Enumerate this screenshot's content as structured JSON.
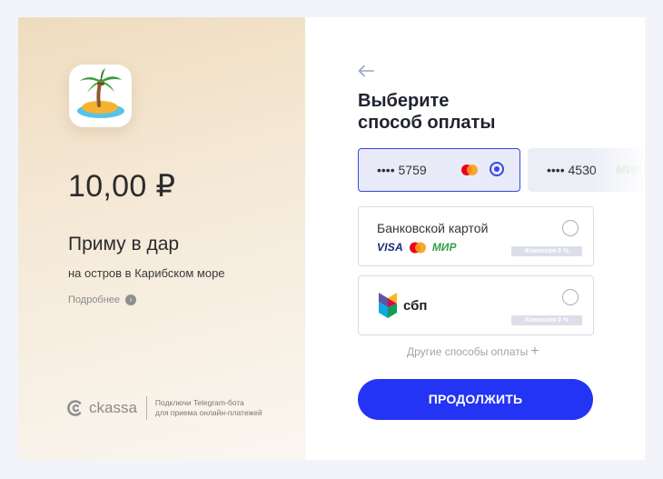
{
  "merchant": {
    "amount": "10,00 ₽",
    "product_title": "Приму в дар",
    "product_description": "на остров в Карибском море",
    "more_link": "Подробнее",
    "icon": "palm-island-icon"
  },
  "brand": {
    "name": "ckassa",
    "promo_line1": "Подключи Telegram-бота",
    "promo_line2": "для приема онлайн-платежей"
  },
  "payment": {
    "title_line1": "Выберите",
    "title_line2": "способ оплаты",
    "saved_cards": [
      {
        "number": "•••• 5759",
        "brand": "mastercard",
        "selected": true
      },
      {
        "number": "•••• 4530",
        "brand_label": "МИР",
        "selected": false
      }
    ],
    "methods": [
      {
        "label": "Банковской картой",
        "logos": {
          "visa": "VISA",
          "mir": "МИР"
        },
        "commission": "Комиссия 0 %"
      },
      {
        "label": "сбп",
        "commission": "Комиссия 0 %"
      }
    ],
    "other_methods": "Другие способы оплаты",
    "continue_label": "ПРОДОЛЖИТЬ"
  },
  "colors": {
    "accent": "#2434f4",
    "selected_border": "#3349e6",
    "left_gradient_top": "#efdcbe",
    "page_bg": "#f3f4fa"
  }
}
